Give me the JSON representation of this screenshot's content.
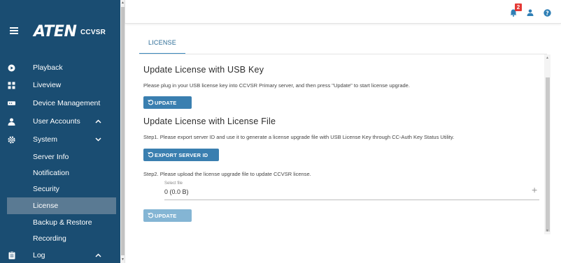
{
  "sidebar": {
    "logo": "ATEN",
    "product": "CCVSR",
    "items": [
      {
        "label": "Playback",
        "icon": "play-icon"
      },
      {
        "label": "Liveview",
        "icon": "grid-icon"
      },
      {
        "label": "Device Management",
        "icon": "device-icon"
      },
      {
        "label": "User Accounts",
        "icon": "user-icon",
        "chevron": "^"
      },
      {
        "label": "System",
        "icon": "gear-icon",
        "chevron": "v"
      },
      {
        "label": "Server Info"
      },
      {
        "label": "Notification"
      },
      {
        "label": "Security"
      },
      {
        "label": "License",
        "active": true
      },
      {
        "label": "Backup & Restore"
      },
      {
        "label": "Recording"
      },
      {
        "label": "Log",
        "icon": "clipboard-icon",
        "chevron": "^"
      }
    ]
  },
  "topbar": {
    "notification_count": "2",
    "icons": [
      "bell-icon",
      "user-icon",
      "help-icon"
    ]
  },
  "tab": {
    "label": "LICENSE"
  },
  "usb_section": {
    "title": "Update License with USB Key",
    "description": "Please plug in your USB license key into CCVSR Primary server, and then press \"Update\" to start license upgrade.",
    "update_label": "UPDATE"
  },
  "file_section": {
    "title": "Update License with License File",
    "step1": "Step1. Please export server ID and use it to generate a license upgrade file with USB License Key through CC-Auth Key Status Utility.",
    "export_label": "EXPORT SERVER ID",
    "step2": "Step2. Please upload the license upgrade file to update CCVSR license.",
    "file_label": "Select file",
    "file_value": "0 (0.0 B)",
    "update_label": "UPDATE"
  },
  "colors": {
    "sidebar_bg": "#1a4d72",
    "active_item_bg": "#5a7a93",
    "accent": "#3a7fb0",
    "badge": "#e53935"
  }
}
